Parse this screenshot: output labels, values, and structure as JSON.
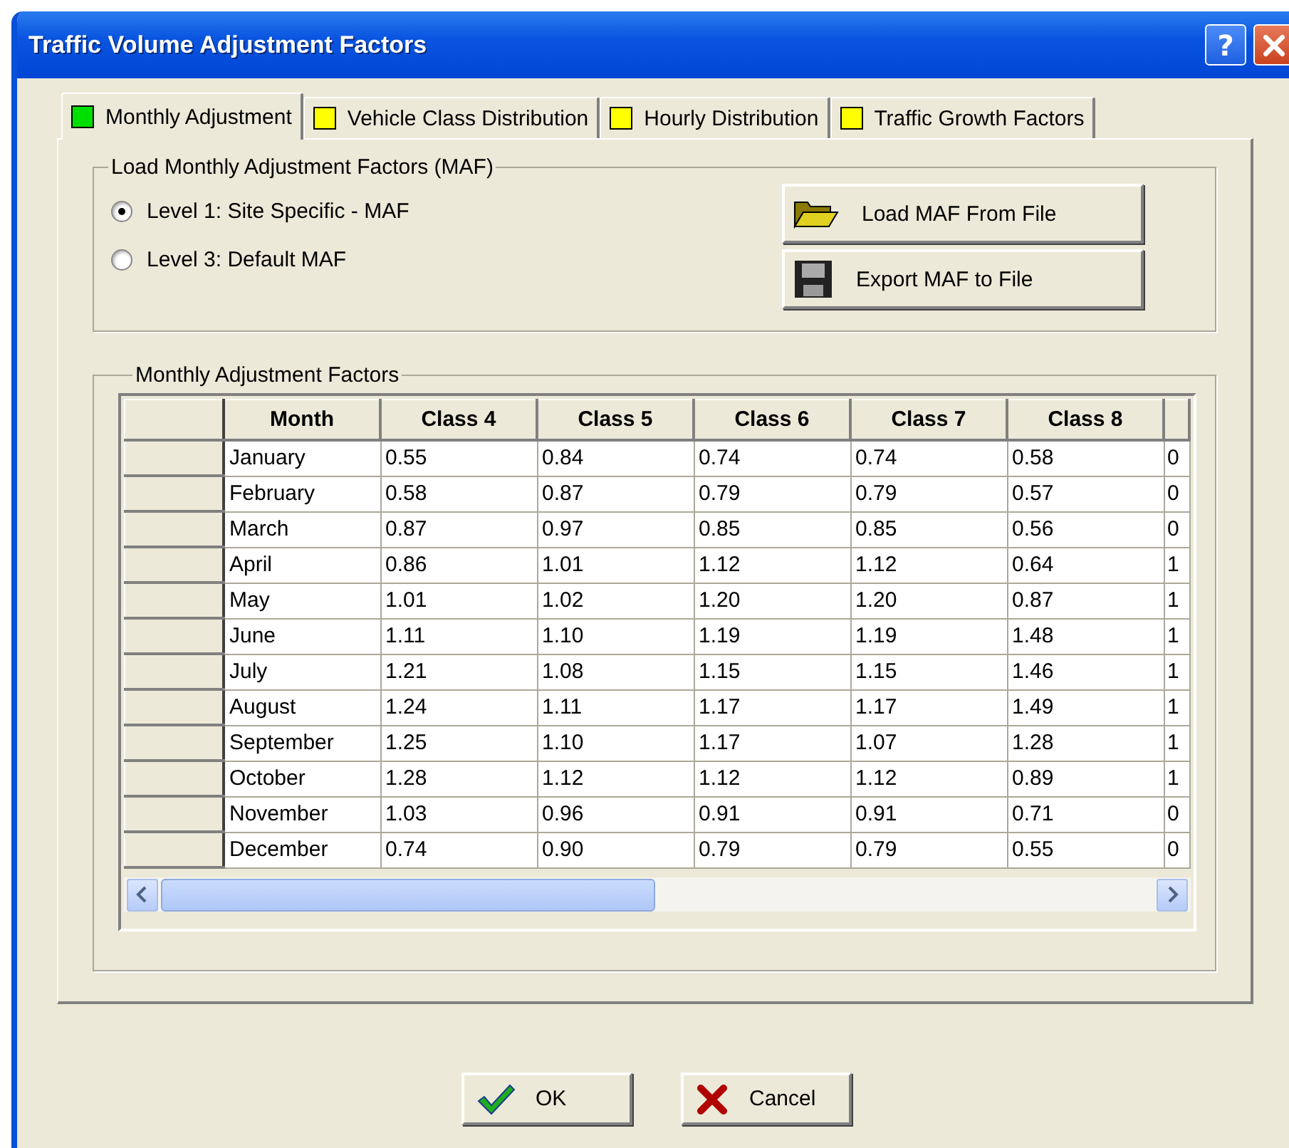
{
  "window": {
    "title": "Traffic Volume Adjustment Factors",
    "help_button": "?"
  },
  "tabs": [
    {
      "label": "Monthly Adjustment",
      "selected": true,
      "color": "#00e000"
    },
    {
      "label": "Vehicle Class Distribution",
      "selected": false,
      "color": "#ffff00"
    },
    {
      "label": "Hourly Distribution",
      "selected": false,
      "color": "#ffff00"
    },
    {
      "label": "Traffic Growth Factors",
      "selected": false,
      "color": "#ffff00"
    }
  ],
  "load_group": {
    "title": "Load Monthly Adjustment Factors (MAF)",
    "options": [
      {
        "label": "Level 1: Site Specific - MAF",
        "selected": true
      },
      {
        "label": "Level 3: Default MAF",
        "selected": false
      }
    ],
    "buttons": [
      {
        "label": "Load  MAF From File",
        "kind": "load"
      },
      {
        "label": "Export MAF to File",
        "kind": "export"
      }
    ]
  },
  "factors_group": {
    "title": "Monthly Adjustment Factors",
    "table": {
      "columns": [
        "Month",
        "Class 4",
        "Class 5",
        "Class 6",
        "Class 7",
        "Class 8"
      ],
      "rows": [
        [
          "January",
          "0.55",
          "0.84",
          "0.74",
          "0.74",
          "0.58",
          "0"
        ],
        [
          "February",
          "0.58",
          "0.87",
          "0.79",
          "0.79",
          "0.57",
          "0"
        ],
        [
          "March",
          "0.87",
          "0.97",
          "0.85",
          "0.85",
          "0.56",
          "0"
        ],
        [
          "April",
          "0.86",
          "1.01",
          "1.12",
          "1.12",
          "0.64",
          "1"
        ],
        [
          "May",
          "1.01",
          "1.02",
          "1.20",
          "1.20",
          "0.87",
          "1"
        ],
        [
          "June",
          "1.11",
          "1.10",
          "1.19",
          "1.19",
          "1.48",
          "1"
        ],
        [
          "July",
          "1.21",
          "1.08",
          "1.15",
          "1.15",
          "1.46",
          "1"
        ],
        [
          "August",
          "1.24",
          "1.11",
          "1.17",
          "1.17",
          "1.49",
          "1"
        ],
        [
          "September",
          "1.25",
          "1.10",
          "1.17",
          "1.07",
          "1.28",
          "1"
        ],
        [
          "October",
          "1.28",
          "1.12",
          "1.12",
          "1.12",
          "0.89",
          "1"
        ],
        [
          "November",
          "1.03",
          "0.96",
          "0.91",
          "0.91",
          "0.71",
          "0"
        ],
        [
          "December",
          "0.74",
          "0.90",
          "0.79",
          "0.79",
          "0.55",
          "0"
        ]
      ]
    }
  },
  "buttons": [
    {
      "label": "OK",
      "kind": "ok"
    },
    {
      "label": "Cancel",
      "kind": "cancel"
    }
  ]
}
